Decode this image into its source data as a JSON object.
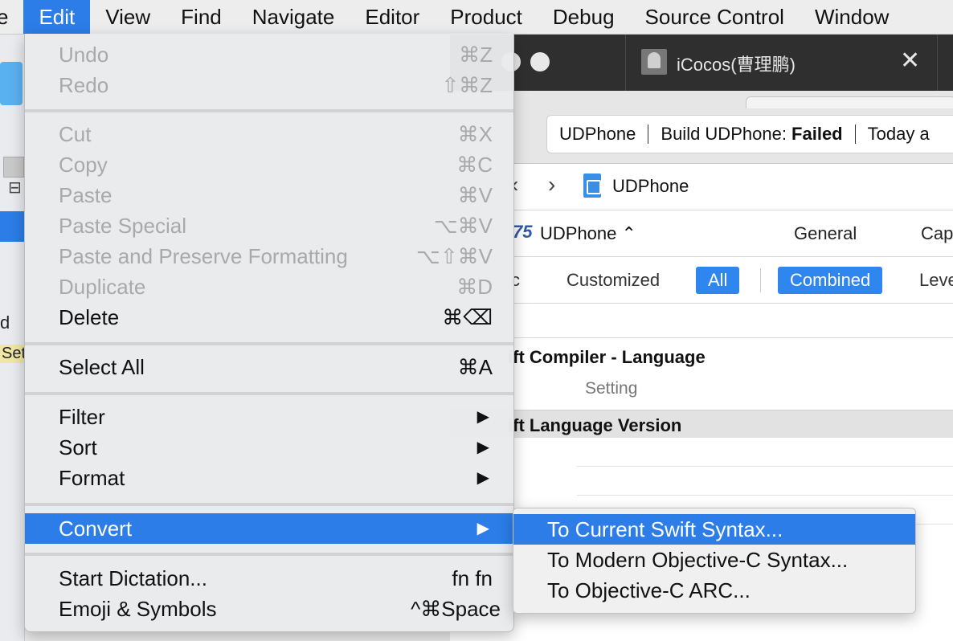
{
  "menubar": {
    "items": [
      "e",
      "Edit",
      "View",
      "Find",
      "Navigate",
      "Editor",
      "Product",
      "Debug",
      "Source Control",
      "Window"
    ],
    "active": "Edit"
  },
  "edit_menu": {
    "undo": {
      "label": "Undo",
      "shortcut": "⌘Z"
    },
    "redo": {
      "label": "Redo",
      "shortcut": "⇧⌘Z"
    },
    "cut": {
      "label": "Cut",
      "shortcut": "⌘X"
    },
    "copy": {
      "label": "Copy",
      "shortcut": "⌘C"
    },
    "paste": {
      "label": "Paste",
      "shortcut": "⌘V"
    },
    "paste_special": {
      "label": "Paste Special",
      "shortcut": "⌥⌘V"
    },
    "paste_preserve": {
      "label": "Paste and Preserve Formatting",
      "shortcut": "⌥⇧⌘V"
    },
    "duplicate": {
      "label": "Duplicate",
      "shortcut": "⌘D"
    },
    "delete": {
      "label": "Delete",
      "shortcut": "⌘⌫"
    },
    "select_all": {
      "label": "Select All",
      "shortcut": "⌘A"
    },
    "filter": {
      "label": "Filter",
      "arrow": "▶"
    },
    "sort": {
      "label": "Sort",
      "arrow": "▶"
    },
    "format": {
      "label": "Format",
      "arrow": "▶"
    },
    "convert": {
      "label": "Convert",
      "arrow": "▶"
    },
    "dictation": {
      "label": "Start Dictation...",
      "shortcut": "fn fn"
    },
    "emoji": {
      "label": "Emoji & Symbols",
      "shortcut": "^⌘Space"
    }
  },
  "convert_submenu": {
    "items": [
      "To Current Swift Syntax...",
      "To Modern Objective-C Syntax...",
      "To Objective-C ARC..."
    ]
  },
  "window": {
    "tab_title": "iCocos(曹理鹏)",
    "tab_close": "✕",
    "activity": {
      "scheme": "UDPhone",
      "status_prefix": "Build UDPhone: ",
      "status_result": "Failed",
      "time": "Today a"
    },
    "jump_bar": {
      "back": "‹",
      "forward": "›",
      "project": "UDPhone"
    },
    "target": {
      "icon": "75",
      "name": "UDPhone ⌃",
      "general": "General",
      "capabilities": "Cap"
    },
    "filters": {
      "basic": "c",
      "customized": "Customized",
      "all": "All",
      "combined": "Combined",
      "levels": "Leve"
    },
    "section": "ift Compiler - Language",
    "column": "Setting",
    "row": "ift Language Version"
  },
  "sidebar": {
    "d": "d",
    "set": "Set",
    "hierarchy_icon": "⊟"
  },
  "colors": {
    "accent": "#2c7de7",
    "menu_bg": "#e9eaec",
    "tabbar": "#2f2f2f"
  }
}
